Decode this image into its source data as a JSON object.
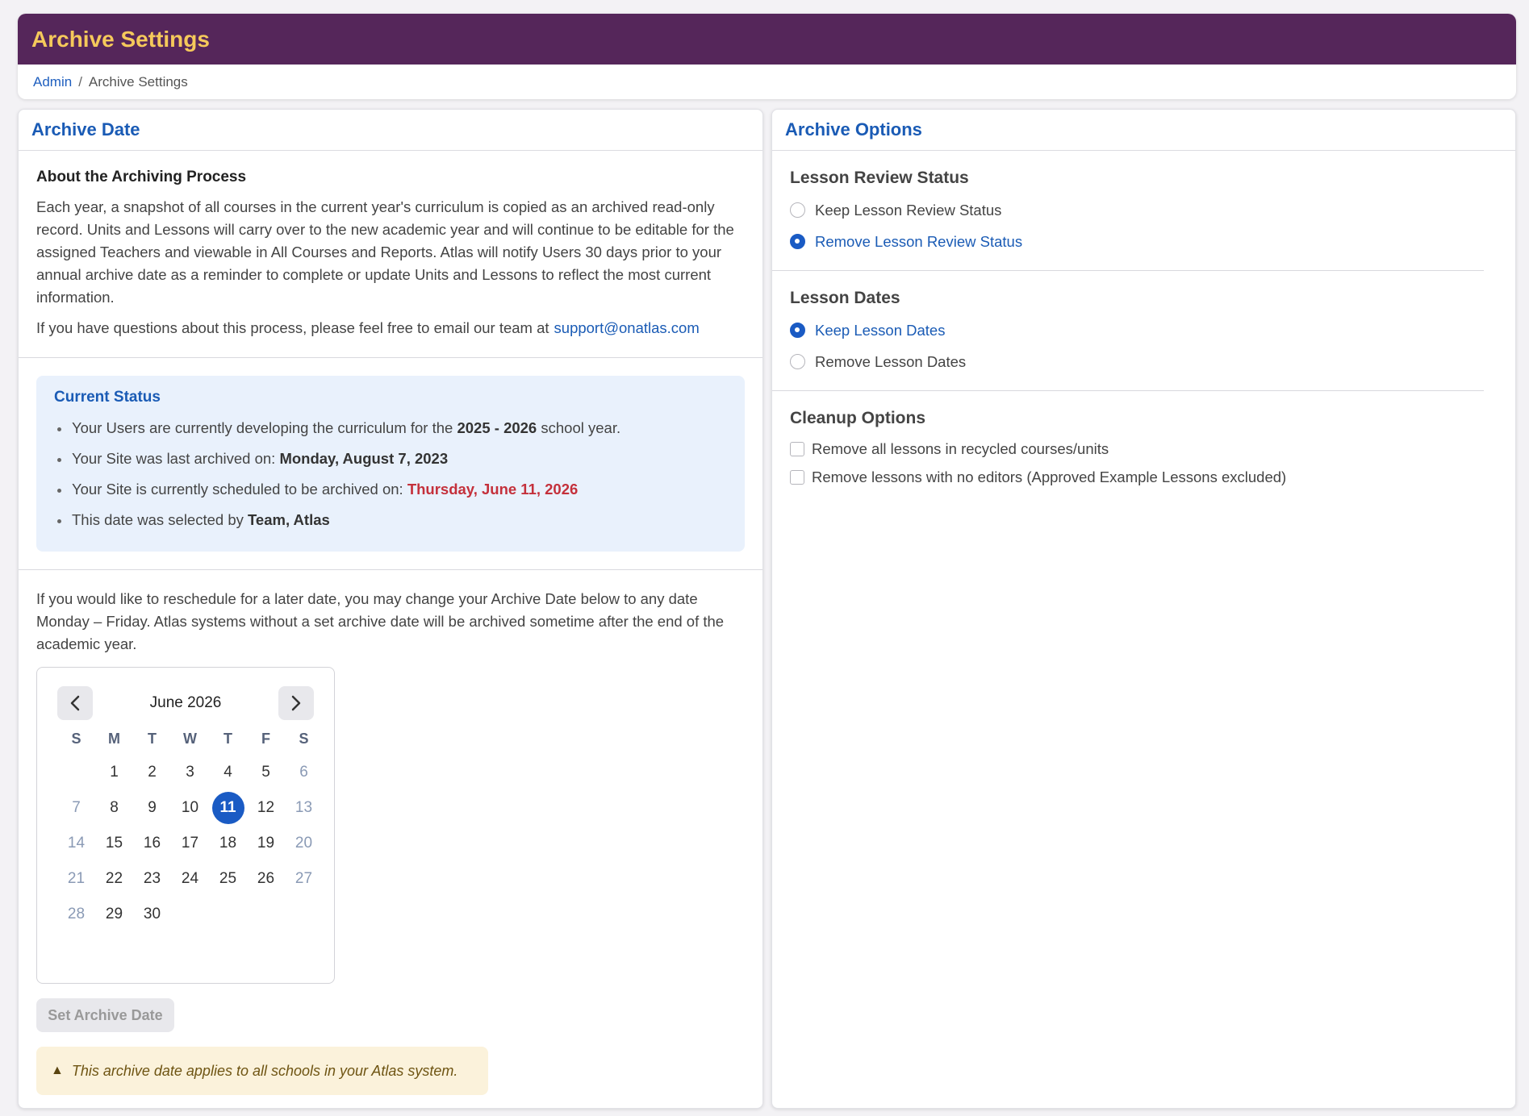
{
  "page": {
    "title": "Archive Settings"
  },
  "breadcrumb": {
    "root": "Admin",
    "separator": "/",
    "current": "Archive Settings"
  },
  "left_panel": {
    "title": "Archive Date",
    "about": {
      "heading": "About the Archiving Process",
      "body": "Each year, a snapshot of all courses in the current year's curriculum is copied as an archived read-only record. Units and Lessons will carry over to the new academic year and will continue to be editable for the assigned Teachers and viewable in All Courses and Reports. Atlas will notify Users 30 days prior to your annual archive date as a reminder to complete or update Units and Lessons to reflect the most current information.",
      "contact_text": "If you have questions about this process, please feel free to email our team at",
      "contact_email": "support@onatlas.com"
    },
    "status": {
      "title": "Current Status",
      "line1_prefix": "Your Users are currently developing the curriculum for the",
      "line1_bold": "2025 - 2026",
      "line1_suffix": "school year.",
      "line2_prefix": "Your Site was last archived on:",
      "line2_bold": "Monday, August 7, 2023",
      "line3_prefix": "Your Site is currently scheduled to be archived on:",
      "line3_red": "Thursday, June 11, 2026",
      "line4_prefix": "This date was selected by",
      "line4_bold": "Team, Atlas"
    },
    "reschedule_text": "If you would like to reschedule for a later date, you may change your Archive Date below to any date Monday – Friday. Atlas systems without a set archive date will be archived sometime after the end of the academic year.",
    "calendar": {
      "month_label": "June 2026",
      "prev_icon": "chevron-left-icon",
      "next_icon": "chevron-right-icon",
      "weekdays": [
        "S",
        "M",
        "T",
        "W",
        "T",
        "F",
        "S"
      ],
      "first_weekday_index": 1,
      "days_in_month": 30,
      "selected_day": 11
    },
    "set_button": "Set Archive Date",
    "warning": {
      "icon": "warning-icon",
      "text": "This archive date applies to all schools in your Atlas system."
    }
  },
  "right_panel": {
    "title": "Archive Options",
    "review_status": {
      "title": "Lesson Review Status",
      "options": [
        {
          "label": "Keep Lesson Review Status",
          "selected": false
        },
        {
          "label": "Remove Lesson Review Status",
          "selected": true
        }
      ]
    },
    "lesson_dates": {
      "title": "Lesson Dates",
      "options": [
        {
          "label": "Keep Lesson Dates",
          "selected": true
        },
        {
          "label": "Remove Lesson Dates",
          "selected": false
        }
      ]
    },
    "cleanup": {
      "title": "Cleanup Options",
      "options": [
        {
          "label": "Remove all lessons in recycled courses/units",
          "checked": false
        },
        {
          "label": "Remove lessons with no editors (Approved Example Lessons excluded)",
          "checked": false
        }
      ]
    }
  },
  "colors": {
    "header_bg": "#55265a",
    "header_title": "#f5c95b",
    "accent_blue": "#1a5bb5",
    "selected_blue": "#1a5bc4",
    "alert_red": "#c4303b",
    "warning_bg": "#fbf2db"
  }
}
